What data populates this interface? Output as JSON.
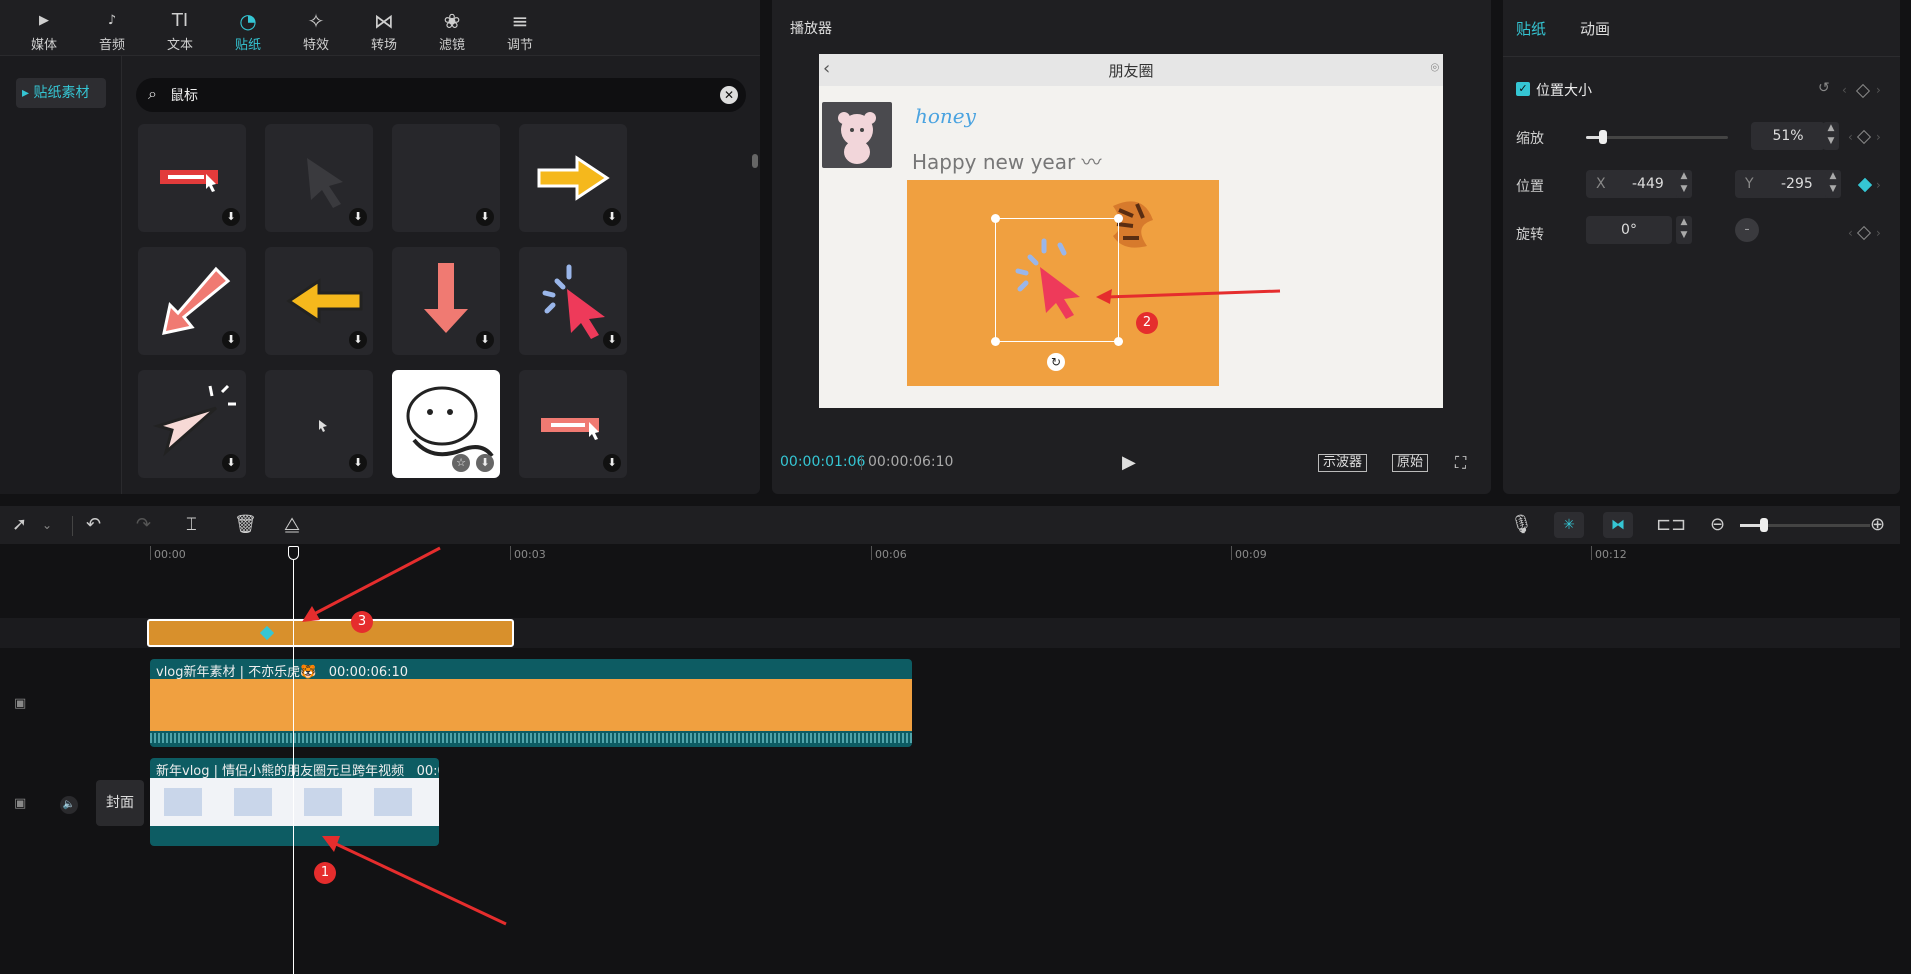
{
  "toolbar": {
    "tabs": [
      {
        "label": "媒体",
        "icon": "media-icon",
        "glyph": "▶"
      },
      {
        "label": "音频",
        "icon": "audio-icon",
        "glyph": "♪"
      },
      {
        "label": "文本",
        "icon": "text-icon",
        "glyph": "TI"
      },
      {
        "label": "贴纸",
        "icon": "sticker-icon",
        "glyph": "◔"
      },
      {
        "label": "特效",
        "icon": "effects-icon",
        "glyph": "✧"
      },
      {
        "label": "转场",
        "icon": "transition-icon",
        "glyph": "⋈"
      },
      {
        "label": "滤镜",
        "icon": "filter-icon",
        "glyph": "❀"
      },
      {
        "label": "调节",
        "icon": "adjust-icon",
        "glyph": "≡"
      }
    ],
    "active": "贴纸"
  },
  "sidebar": {
    "item": "贴纸素材"
  },
  "search": {
    "value": "鼠标"
  },
  "sticker_grid": {
    "tiles": [
      "sticker-1",
      "sticker-2",
      "sticker-3",
      "sticker-4",
      "sticker-5",
      "sticker-6",
      "sticker-7",
      "sticker-8",
      "sticker-9",
      "sticker-10",
      "sticker-11",
      "sticker-12"
    ]
  },
  "player": {
    "title": "播放器",
    "preview_title": "朋友圈",
    "honey": "honey",
    "greeting": "Happy new year 〰",
    "time_current": "00:00:01:06",
    "time_total": "00:00:06:10",
    "scope_label": "示波器",
    "original_label": "原始"
  },
  "props": {
    "tabs": [
      "贴纸",
      "动画"
    ],
    "section": "位置大小",
    "scale_label": "缩放",
    "scale_value": "51%",
    "scale_fraction": 0.51,
    "position_label": "位置",
    "pos_x_label": "X",
    "pos_x": "-449",
    "pos_y_label": "Y",
    "pos_y": "-295",
    "rotate_label": "旋转",
    "rotate_value": "0°"
  },
  "timeline": {
    "ticks": [
      "00:00",
      "00:03",
      "00:06",
      "00:09",
      "00:12"
    ],
    "vlog_clip_label": "vlog新年素材 | 不亦乐虎🐯",
    "vlog_clip_duration": "00:00:06:10",
    "main_clip_label": "新年vlog | 情侣小熊的朋友圈元旦跨年视频",
    "main_clip_duration": "00:0",
    "cover_label": "封面"
  },
  "annotations": [
    "1",
    "2",
    "3"
  ],
  "colors": {
    "accent": "#35c6d4",
    "orange": "#f0a040",
    "teal": "#0d5c63",
    "red": "#e52d2d"
  }
}
